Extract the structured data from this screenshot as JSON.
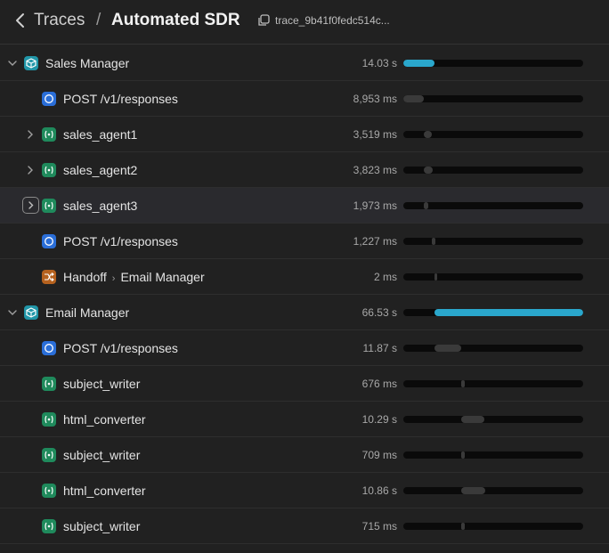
{
  "header": {
    "traces_label": "Traces",
    "separator": "/",
    "title": "Automated SDR",
    "trace_id": "trace_9b41f0fedc514c..."
  },
  "rows": [
    {
      "label": "Sales Manager",
      "duration": "14.03 s",
      "icon": "agent-cube-icon",
      "indent": 0,
      "chevron": "expanded",
      "bar_start": 0.0,
      "bar_width": 0.175,
      "bar_color": "blue"
    },
    {
      "label": "POST /v1/responses",
      "duration": "8,953 ms",
      "icon": "post-response-icon",
      "indent": 1,
      "chevron": "none",
      "bar_start": 0.0,
      "bar_width": 0.115,
      "bar_color": "grey"
    },
    {
      "label": "sales_agent1",
      "duration": "3,519 ms",
      "icon": "agent-tool-icon",
      "indent": 1,
      "chevron": "collapsed",
      "bar_start": 0.115,
      "bar_width": 0.045,
      "bar_color": "grey"
    },
    {
      "label": "sales_agent2",
      "duration": "3,823 ms",
      "icon": "agent-tool-icon",
      "indent": 1,
      "chevron": "collapsed",
      "bar_start": 0.115,
      "bar_width": 0.05,
      "bar_color": "grey"
    },
    {
      "label": "sales_agent3",
      "duration": "1,973 ms",
      "icon": "agent-tool-icon",
      "indent": 1,
      "chevron": "collapsed-boxed",
      "bar_start": 0.115,
      "bar_width": 0.025,
      "bar_color": "grey"
    },
    {
      "label": "POST /v1/responses",
      "duration": "1,227 ms",
      "icon": "post-response-icon",
      "indent": 1,
      "chevron": "none",
      "bar_start": 0.16,
      "bar_width": 0.018,
      "bar_color": "grey"
    },
    {
      "label": "Handoff",
      "label_target": "Email Manager",
      "duration": "2 ms",
      "icon": "handoff-icon",
      "indent": 1,
      "chevron": "none",
      "bar_start": 0.175,
      "bar_width": 0.012,
      "bar_color": "grey"
    },
    {
      "label": "Email Manager",
      "duration": "66.53 s",
      "icon": "agent-cube-icon",
      "indent": 0,
      "chevron": "expanded",
      "bar_start": 0.175,
      "bar_width": 0.825,
      "bar_color": "blue"
    },
    {
      "label": "POST /v1/responses",
      "duration": "11.87 s",
      "icon": "post-response-icon",
      "indent": 1,
      "chevron": "none",
      "bar_start": 0.175,
      "bar_width": 0.148,
      "bar_color": "grey"
    },
    {
      "label": "subject_writer",
      "duration": "676 ms",
      "icon": "agent-tool-icon",
      "indent": 1,
      "chevron": "none",
      "bar_start": 0.323,
      "bar_width": 0.018,
      "bar_color": "grey"
    },
    {
      "label": "html_converter",
      "duration": "10.29 s",
      "icon": "agent-tool-icon",
      "indent": 1,
      "chevron": "none",
      "bar_start": 0.323,
      "bar_width": 0.128,
      "bar_color": "grey"
    },
    {
      "label": "subject_writer",
      "duration": "709 ms",
      "icon": "agent-tool-icon",
      "indent": 1,
      "chevron": "none",
      "bar_start": 0.323,
      "bar_width": 0.018,
      "bar_color": "grey"
    },
    {
      "label": "html_converter",
      "duration": "10.86 s",
      "icon": "agent-tool-icon",
      "indent": 1,
      "chevron": "none",
      "bar_start": 0.323,
      "bar_width": 0.135,
      "bar_color": "grey"
    },
    {
      "label": "subject_writer",
      "duration": "715 ms",
      "icon": "agent-tool-icon",
      "indent": 1,
      "chevron": "none",
      "bar_start": 0.323,
      "bar_width": 0.018,
      "bar_color": "grey"
    }
  ]
}
